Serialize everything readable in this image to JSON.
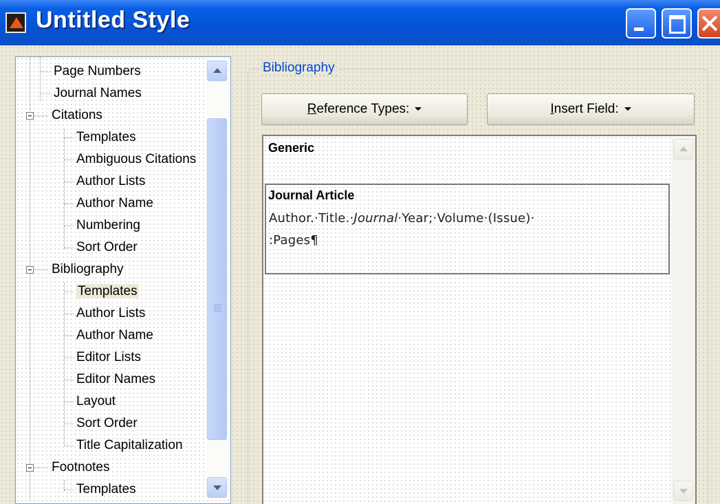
{
  "window": {
    "title": "Untitled Style"
  },
  "tree": {
    "items": [
      {
        "label": "Page Numbers",
        "level": 1,
        "selected": false
      },
      {
        "label": "Journal Names",
        "level": 1,
        "selected": false
      },
      {
        "label": "Citations",
        "level": 0,
        "expanded": true
      },
      {
        "label": "Templates",
        "level": 1,
        "selected": false
      },
      {
        "label": "Ambiguous Citations",
        "level": 1,
        "selected": false
      },
      {
        "label": "Author Lists",
        "level": 1,
        "selected": false
      },
      {
        "label": "Author Name",
        "level": 1,
        "selected": false
      },
      {
        "label": "Numbering",
        "level": 1,
        "selected": false
      },
      {
        "label": "Sort Order",
        "level": 1,
        "selected": false
      },
      {
        "label": "Bibliography",
        "level": 0,
        "expanded": true
      },
      {
        "label": "Templates",
        "level": 1,
        "selected": true
      },
      {
        "label": "Author Lists",
        "level": 1,
        "selected": false
      },
      {
        "label": "Author Name",
        "level": 1,
        "selected": false
      },
      {
        "label": "Editor Lists",
        "level": 1,
        "selected": false
      },
      {
        "label": "Editor Names",
        "level": 1,
        "selected": false
      },
      {
        "label": "Layout",
        "level": 1,
        "selected": false
      },
      {
        "label": "Sort Order",
        "level": 1,
        "selected": false
      },
      {
        "label": "Title Capitalization",
        "level": 1,
        "selected": false
      },
      {
        "label": "Footnotes",
        "level": 0,
        "expanded": true
      },
      {
        "label": "Templates",
        "level": 1,
        "selected": false
      }
    ]
  },
  "bibliography": {
    "group_label": "Bibliography",
    "reference_types_button": {
      "first": "R",
      "rest": "eference Types:"
    },
    "insert_field_button": {
      "first": "I",
      "rest": "nsert Field:"
    },
    "templates": {
      "generic": "Generic",
      "journal_article": {
        "title": "Journal Article",
        "author": "Author.",
        "title_field": "Title.",
        "journal": "Journal",
        "year": "Year;",
        "volume": "Volume",
        "issue": "(Issue)",
        "pages": ":Pages¶"
      }
    }
  },
  "colors": {
    "titlebar": "#0553d6",
    "group_label": "#0046d5",
    "face": "#ece9d8"
  }
}
